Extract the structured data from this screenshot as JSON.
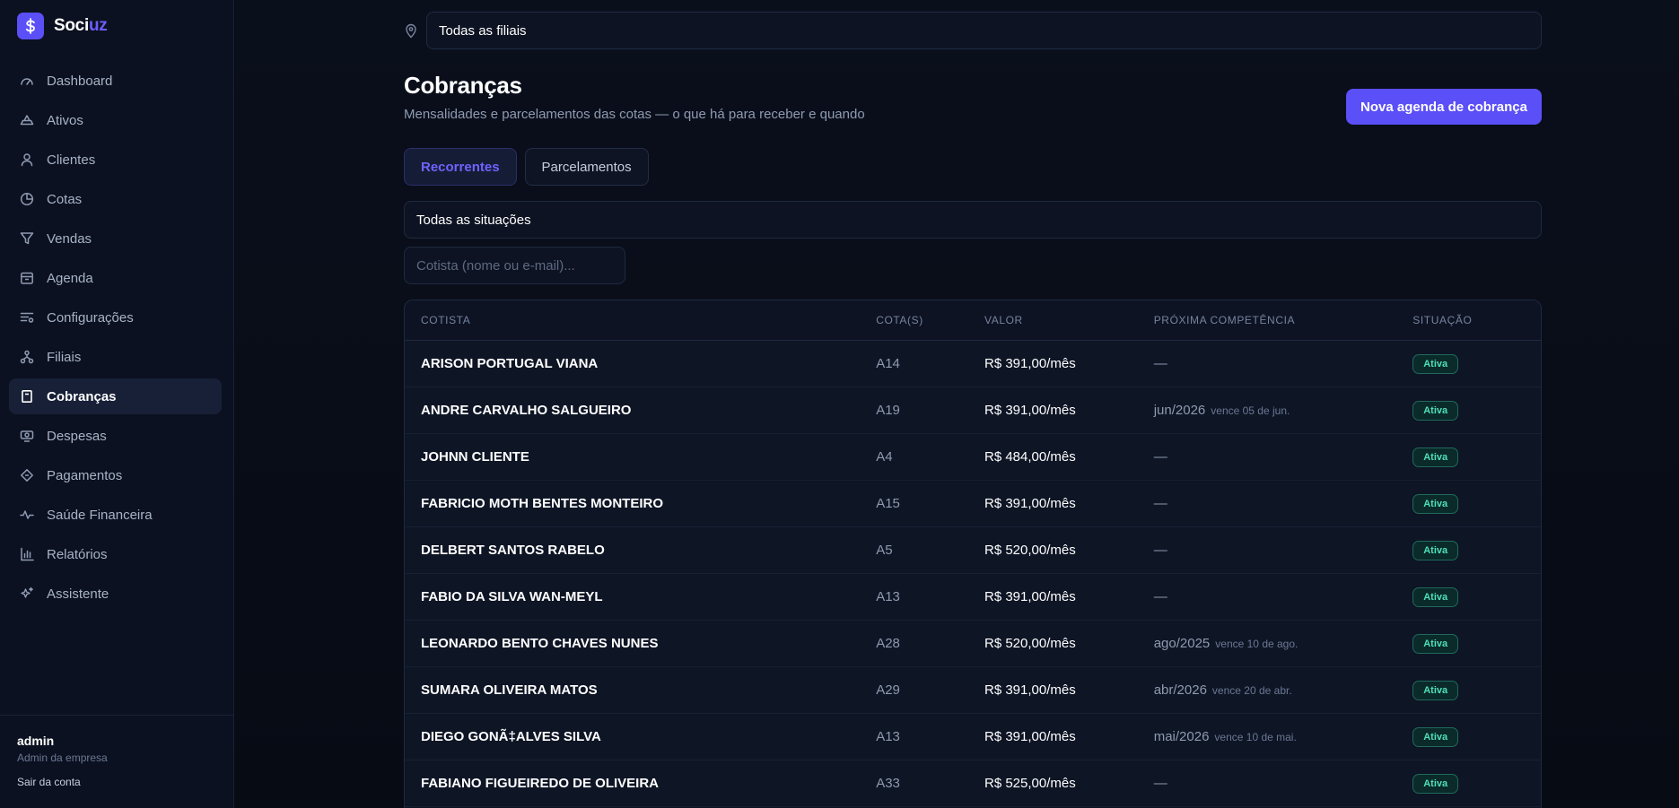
{
  "brand": {
    "name_main": "Soci",
    "name_accent": "uz",
    "accent_color": "#6d5dfc"
  },
  "sidebar": {
    "items": [
      {
        "label": "Dashboard",
        "icon": "gauge-icon"
      },
      {
        "label": "Ativos",
        "icon": "asset-icon"
      },
      {
        "label": "Clientes",
        "icon": "user-icon"
      },
      {
        "label": "Cotas",
        "icon": "pie-chart-icon"
      },
      {
        "label": "Vendas",
        "icon": "filter-icon"
      },
      {
        "label": "Agenda",
        "icon": "calendar-icon"
      },
      {
        "label": "Configurações",
        "icon": "settings-list-icon"
      },
      {
        "label": "Filiais",
        "icon": "branches-icon"
      },
      {
        "label": "Cobranças",
        "icon": "receipt-icon",
        "active": true
      },
      {
        "label": "Despesas",
        "icon": "money-icon"
      },
      {
        "label": "Pagamentos",
        "icon": "diamond-icon"
      },
      {
        "label": "Saúde Financeira",
        "icon": "pulse-icon"
      },
      {
        "label": "Relatórios",
        "icon": "bar-chart-icon"
      },
      {
        "label": "Assistente",
        "icon": "sparkle-icon"
      }
    ],
    "footer": {
      "user": "admin",
      "role": "Admin da empresa",
      "logout": "Sair da conta"
    }
  },
  "branch_filter": {
    "value": "Todas as filiais"
  },
  "header": {
    "title": "Cobranças",
    "subtitle": "Mensalidades e parcelamentos das cotas — o que há para receber e quando",
    "primary_button": "Nova agenda de cobrança"
  },
  "tabs": [
    {
      "label": "Recorrentes",
      "active": true
    },
    {
      "label": "Parcelamentos",
      "active": false
    }
  ],
  "status_filter": {
    "value": "Todas as situações"
  },
  "search": {
    "placeholder": "Cotista (nome ou e-mail)..."
  },
  "table": {
    "columns": [
      "COTISTA",
      "COTA(S)",
      "VALOR",
      "PRÓXIMA COMPETÊNCIA",
      "SITUAÇÃO"
    ],
    "rows": [
      {
        "name": "ARISON PORTUGAL VIANA",
        "cota": "A14",
        "valor": "R$ 391,00/mês",
        "competencia": "—",
        "vence": "",
        "status": "Ativa"
      },
      {
        "name": "ANDRE CARVALHO SALGUEIRO",
        "cota": "A19",
        "valor": "R$ 391,00/mês",
        "competencia": "jun/2026",
        "vence": "vence 05 de jun.",
        "status": "Ativa"
      },
      {
        "name": "JOHNN CLIENTE",
        "cota": "A4",
        "valor": "R$ 484,00/mês",
        "competencia": "—",
        "vence": "",
        "status": "Ativa"
      },
      {
        "name": "FABRICIO MOTH BENTES MONTEIRO",
        "cota": "A15",
        "valor": "R$ 391,00/mês",
        "competencia": "—",
        "vence": "",
        "status": "Ativa"
      },
      {
        "name": "DELBERT SANTOS RABELO",
        "cota": "A5",
        "valor": "R$ 520,00/mês",
        "competencia": "—",
        "vence": "",
        "status": "Ativa"
      },
      {
        "name": "FABIO DA SILVA WAN-MEYL",
        "cota": "A13",
        "valor": "R$ 391,00/mês",
        "competencia": "—",
        "vence": "",
        "status": "Ativa"
      },
      {
        "name": "LEONARDO BENTO CHAVES NUNES",
        "cota": "A28",
        "valor": "R$ 520,00/mês",
        "competencia": "ago/2025",
        "vence": "vence 10 de ago.",
        "status": "Ativa"
      },
      {
        "name": "SUMARA OLIVEIRA MATOS",
        "cota": "A29",
        "valor": "R$ 391,00/mês",
        "competencia": "abr/2026",
        "vence": "vence 20 de abr.",
        "status": "Ativa"
      },
      {
        "name": "DIEGO GONÃ‡ALVES SILVA",
        "cota": "A13",
        "valor": "R$ 391,00/mês",
        "competencia": "mai/2026",
        "vence": "vence 10 de mai.",
        "status": "Ativa"
      },
      {
        "name": "FABIANO FIGUEIREDO DE OLIVEIRA",
        "cota": "A33",
        "valor": "R$ 525,00/mês",
        "competencia": "—",
        "vence": "",
        "status": "Ativa"
      }
    ]
  },
  "colors": {
    "primary": "#5b4ff7",
    "status_active": "#4ee0b8",
    "background": "#070b14"
  }
}
